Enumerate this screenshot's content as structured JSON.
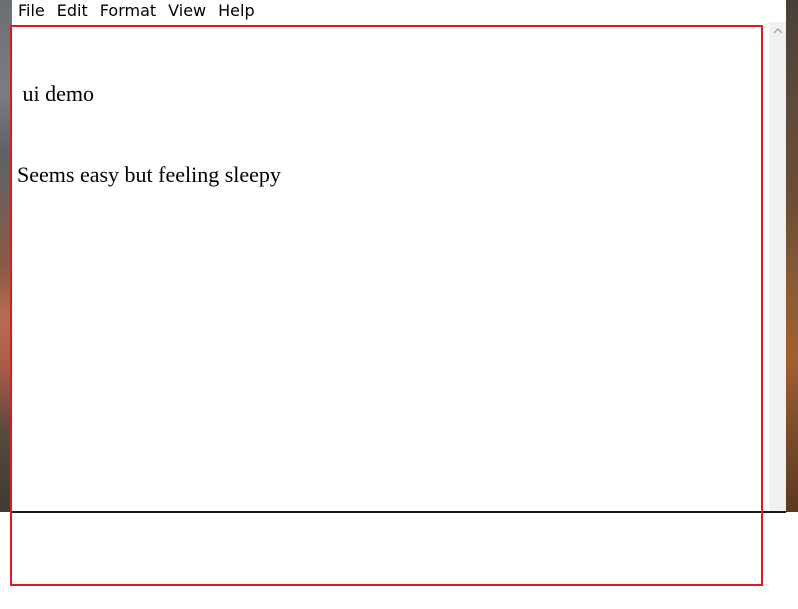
{
  "menu": {
    "items": [
      {
        "label": "File"
      },
      {
        "label": "Edit"
      },
      {
        "label": "Format"
      },
      {
        "label": "View"
      },
      {
        "label": "Help"
      }
    ]
  },
  "editor": {
    "lines": [
      " ui demo",
      "Seems easy but feeling sleepy"
    ]
  },
  "colors": {
    "highlight_border": "#e0191e",
    "scrollbar_track": "#f0f0f0",
    "text": "#000000"
  },
  "icons": {
    "scroll_up": "chevron-up-icon"
  }
}
